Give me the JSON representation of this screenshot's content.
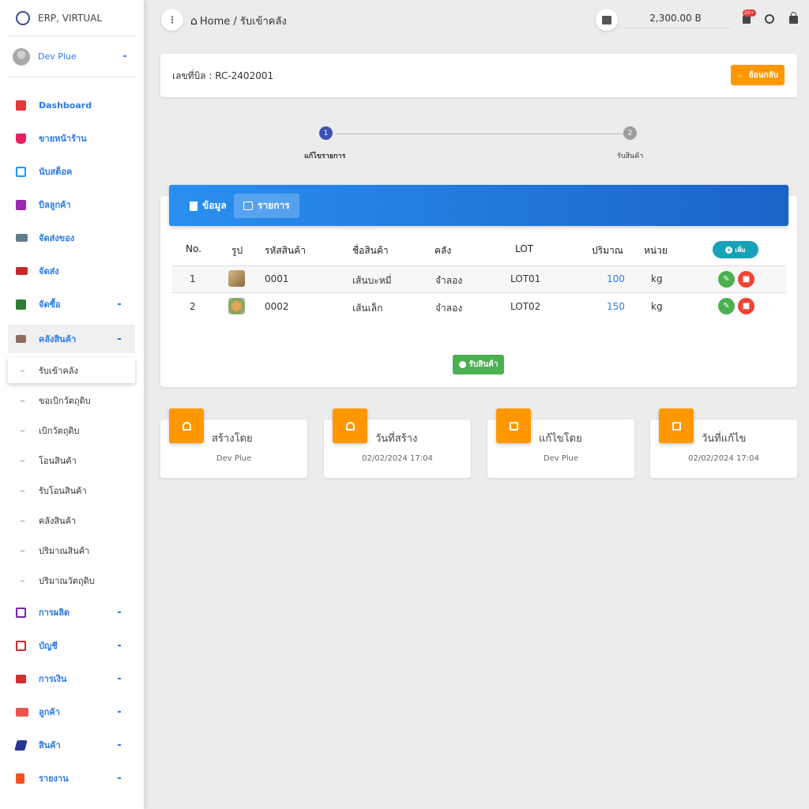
{
  "brand": {
    "name": "ERP, VIRTUAL"
  },
  "user": {
    "name": "Dev Plue"
  },
  "sidebar": {
    "items": [
      {
        "label": "Dashboard",
        "icon": "dashboard-icon",
        "color": "#e53935"
      },
      {
        "label": "ขายหน้าร้าน",
        "icon": "basket-icon",
        "color": "#e91e63"
      },
      {
        "label": "นับสต็อค",
        "icon": "tablet-icon",
        "color": "#2196f3"
      },
      {
        "label": "บิลลูกค้า",
        "icon": "invoice-icon",
        "color": "#9c27b0"
      },
      {
        "label": "จัดส่งของ",
        "icon": "truck-icon",
        "color": "#607d8b"
      },
      {
        "label": "จัดส่ง",
        "icon": "truck-red-icon",
        "color": "#c62828"
      },
      {
        "label": "จัดซื้อ",
        "icon": "list-icon",
        "color": "#2e7d32"
      },
      {
        "label": "คลังสินค้า",
        "icon": "warehouse-icon",
        "color": "#8d6e63"
      }
    ],
    "sub_items": [
      {
        "label": "รับเข้าคลัง"
      },
      {
        "label": "ขอเบิกวัตถุดิบ"
      },
      {
        "label": "เบิกวัตถุดิบ"
      },
      {
        "label": "โอนสินค้า"
      },
      {
        "label": "รับโอนสินค้า"
      },
      {
        "label": "คลังสินค้า"
      },
      {
        "label": "ปริมาณสินค้า"
      },
      {
        "label": "ปริมาณวัตถุดิบ"
      }
    ],
    "bottom_items": [
      {
        "label": "การผลิต",
        "icon": "production-icon",
        "color": "#7b1fa2"
      },
      {
        "label": "บัญชี",
        "icon": "accounting-icon",
        "color": "#c62828"
      },
      {
        "label": "การเงิน",
        "icon": "bank-icon",
        "color": "#d32f2f"
      },
      {
        "label": "ลูกค้า",
        "icon": "contact-card-icon",
        "color": "#ef5350"
      },
      {
        "label": "สินค้า",
        "icon": "product-icon",
        "color": "#283593"
      },
      {
        "label": "รายงาน",
        "icon": "report-icon",
        "color": "#f4511e"
      }
    ]
  },
  "topbar": {
    "breadcrumb": "Home / รับเข้าคลัง",
    "balance": "2,300.00 B",
    "notification_badge": "20+"
  },
  "bill": {
    "number_label": "เลขที่บิล : RC-2402001",
    "back_label": "ย้อนกลับ"
  },
  "stepper": {
    "steps": [
      {
        "number": "1",
        "label": "แก้ไขรายการ",
        "color": "#3f51b5"
      },
      {
        "number": "2",
        "label": "รับสินค้า",
        "color": "#9e9e9e"
      }
    ]
  },
  "tabs": [
    {
      "label": "ข้อมูล"
    },
    {
      "label": "รายการ"
    }
  ],
  "table": {
    "headers": [
      "No.",
      "รูป",
      "รหัสสินค้า",
      "ชื่อสินค้า",
      "คลัง",
      "LOT",
      "ปริมาณ",
      "หน่วย"
    ],
    "add_label": "เพิ่ม",
    "rows": [
      {
        "no": "1",
        "code": "0001",
        "name": "เส้นบะหมี่",
        "warehouse": "จำลอง",
        "lot": "LOT01",
        "qty": "100",
        "unit": "kg"
      },
      {
        "no": "2",
        "code": "0002",
        "name": "เส้นเล็ก",
        "warehouse": "จำลอง",
        "lot": "LOT02",
        "qty": "150",
        "unit": "kg"
      }
    ],
    "receive_label": "รับสินค้า"
  },
  "info_cards": [
    {
      "title": "สร้างโดย",
      "value": "Dev Plue",
      "icon": "person-icon"
    },
    {
      "title": "วันที่สร้าง",
      "value": "02/02/2024 17:04",
      "icon": "person-outline-icon"
    },
    {
      "title": "แก้ไขโดย",
      "value": "Dev Plue",
      "icon": "calendar-icon"
    },
    {
      "title": "วันที่แก้ไข",
      "value": "02/02/2024 17:04",
      "icon": "calendar-grid-icon"
    }
  ],
  "colors": {
    "accent": "#2c7be5",
    "orange": "#ff9800",
    "green": "#4caf50",
    "red": "#f44336",
    "teal": "#17a2b8"
  }
}
